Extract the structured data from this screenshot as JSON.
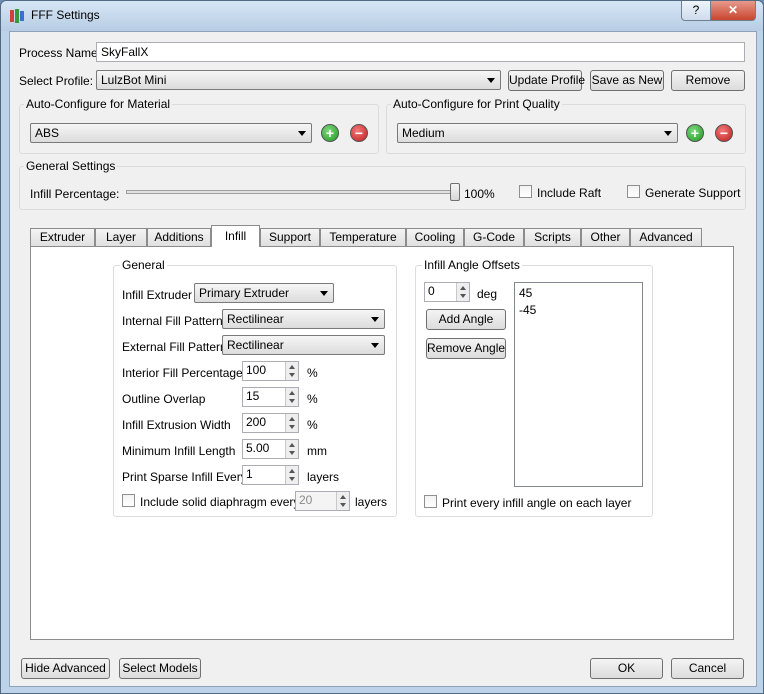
{
  "window": {
    "title": "FFF Settings",
    "help": "?",
    "close": "✕"
  },
  "process": {
    "label": "Process Name:",
    "value": "SkyFallX"
  },
  "profile": {
    "label": "Select Profile:",
    "value": "LulzBot Mini",
    "update": "Update Profile",
    "save_as_new": "Save as New",
    "remove": "Remove"
  },
  "material": {
    "title": "Auto-Configure for Material",
    "value": "ABS"
  },
  "quality": {
    "title": "Auto-Configure for Print Quality",
    "value": "Medium"
  },
  "general_settings": {
    "title": "General Settings",
    "infill_label": "Infill Percentage:",
    "infill_value": "100%",
    "infill_fraction": 1.0,
    "include_raft": "Include Raft",
    "generate_support": "Generate Support"
  },
  "tabs": [
    "Extruder",
    "Layer",
    "Additions",
    "Infill",
    "Support",
    "Temperature",
    "Cooling",
    "G-Code",
    "Scripts",
    "Other",
    "Advanced"
  ],
  "active_tab": "Infill",
  "infill_general": {
    "title": "General",
    "extruder_label": "Infill Extruder",
    "extruder_value": "Primary Extruder",
    "internal_label": "Internal Fill Pattern",
    "internal_value": "Rectilinear",
    "external_label": "External Fill Pattern",
    "external_value": "Rectilinear",
    "interior_pct_label": "Interior Fill Percentage",
    "interior_pct_value": "100",
    "pct_unit": "%",
    "outline_label": "Outline Overlap",
    "outline_value": "15",
    "width_label": "Infill Extrusion Width",
    "width_value": "200",
    "min_len_label": "Minimum Infill Length",
    "min_len_value": "5.00",
    "mm_unit": "mm",
    "sparse_label": "Print Sparse Infill Every",
    "sparse_value": "1",
    "layers_unit": "layers",
    "diaphragm_label": "Include solid diaphragm every",
    "diaphragm_value": "20"
  },
  "angles": {
    "title": "Infill Angle Offsets",
    "input_value": "0",
    "deg_unit": "deg",
    "add": "Add Angle",
    "remove": "Remove Angle",
    "list": [
      "45",
      "-45"
    ],
    "print_every": "Print every infill angle on each layer"
  },
  "footer": {
    "hide_advanced": "Hide Advanced",
    "select_models": "Select Models",
    "ok": "OK",
    "cancel": "Cancel"
  }
}
